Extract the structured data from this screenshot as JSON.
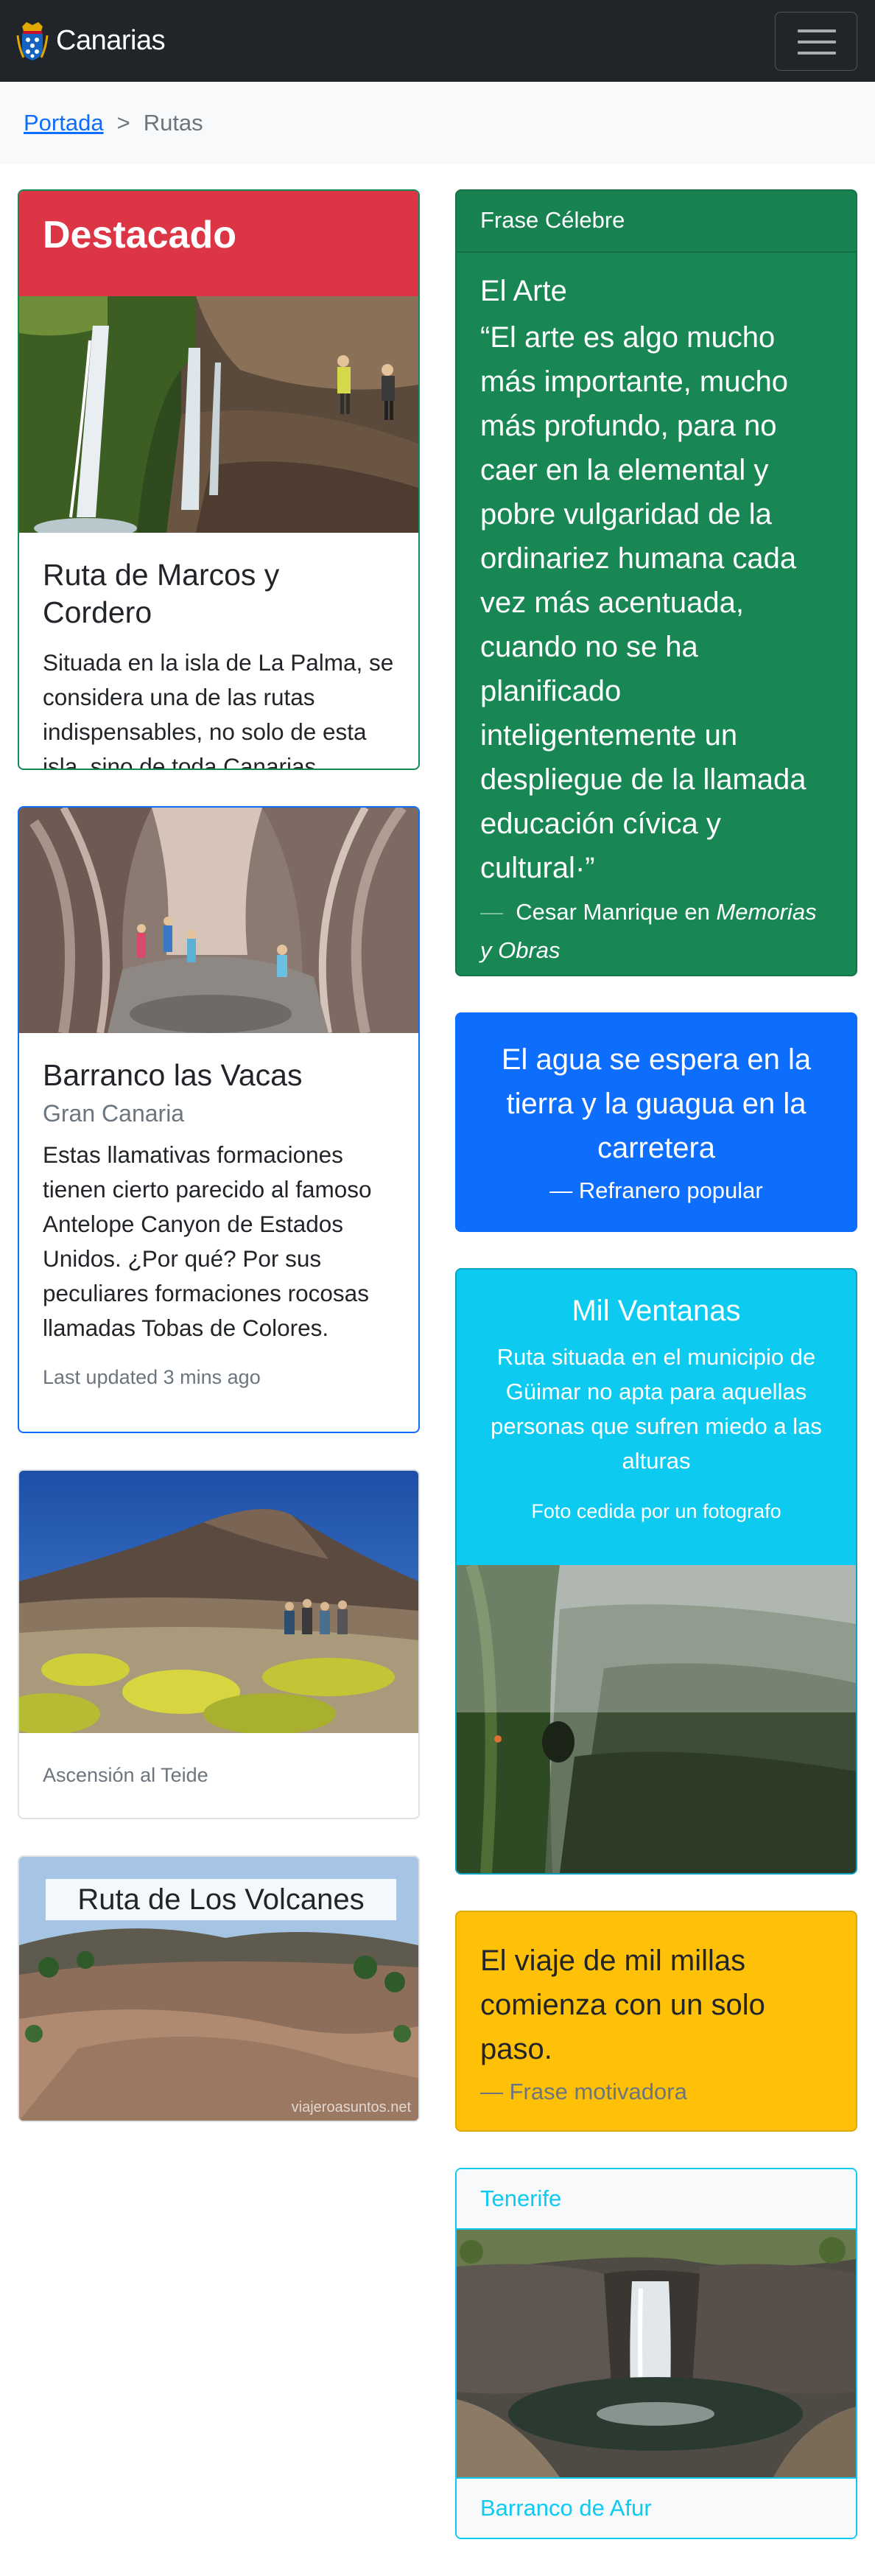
{
  "navbar": {
    "brand": "Canarias",
    "logo_icon": "canarias-coat-of-arms-icon",
    "toggler_icon": "hamburger-menu-icon"
  },
  "breadcrumb": {
    "home": "Portada",
    "separator": ">",
    "current": "Rutas"
  },
  "cards": {
    "featured": {
      "header": "Destacado",
      "title": "Ruta de Marcos y Cordero",
      "text": "Situada en la isla de La Palma, se considera una de las rutas indispensables, no solo de esta isla, sino de toda Canarias."
    },
    "barranco": {
      "title": "Barranco las Vacas",
      "subtitle": "Gran Canaria",
      "text": "Estas llamativas formaciones tienen cierto parecido al famoso Antelope Canyon de Estados Unidos. ¿Por qué? Por sus peculiares formaciones rocosas llamadas Tobas de Colores.",
      "updated": "Last updated 3 mins ago"
    },
    "teide": {
      "caption": "Ascensión al Teide"
    },
    "volcanes": {
      "title": "Ruta de Los Volcanes",
      "watermark": "viajeroasuntos.net"
    },
    "quote_arte": {
      "header": "Frase Célebre",
      "title": "El Arte",
      "quote": "“El arte es algo mucho más importante, mucho más profundo, para no caer en la elemental y pobre vulgaridad de la ordinariez humana cada vez más acentuada, cuando no se ha planificado inteligentemente un despliegue de la llamada educación cívica y cultural·”",
      "dash": "—",
      "author": "Cesar Manrique en ",
      "source": "Memorias y Obras"
    },
    "quote_agua": {
      "quote": "El agua se espera en la tierra y la guagua en la carretera",
      "footer": "—  Refranero popular"
    },
    "ventanas": {
      "title": "Mil Ventanas",
      "text": "Ruta situada en el municipio de Güimar no apta para aquellas personas que sufren miedo a las alturas",
      "note": "Foto cedida por un fotografo"
    },
    "quote_viaje": {
      "quote": "El viaje de mil millas comienza con un solo paso.",
      "footer": "—  Frase motivadora"
    },
    "tenerife": {
      "header": "Tenerife",
      "footer": "Barranco de Afur"
    }
  },
  "colors": {
    "navbar": "#212529",
    "danger": "#dc3545",
    "success": "#198754",
    "primary": "#0d6efd",
    "info": "#0dcaf0",
    "warning": "#ffc107"
  }
}
